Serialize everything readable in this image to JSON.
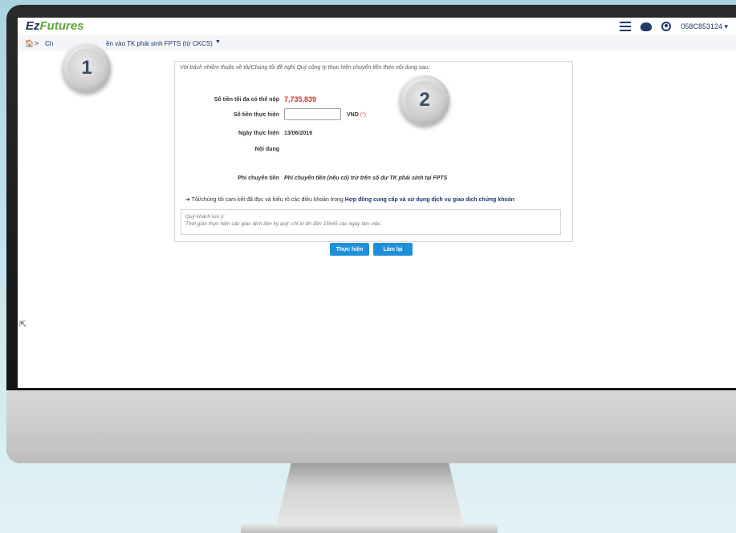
{
  "app": {
    "logo_ez": "Ez",
    "logo_futures": "Futures"
  },
  "header": {
    "account": "058C853124 ▾"
  },
  "breadcrumb": {
    "home": "🏠",
    "separator": ">",
    "prefix": "Ch",
    "current": "ền vào TK phái sinh FPTS (từ CKCS)",
    "caret": "▼"
  },
  "badges": {
    "one": "1",
    "two": "2"
  },
  "form": {
    "intro": "Với trách nhiệm thuộc về tôi/Chúng tôi đề nghị Quý công ty thực hiện chuyển tiền theo nội dung sau:",
    "max_label": "Số tiền tối đa có thể nộp",
    "max_value": "7,735,839",
    "amount_label": "Số tiền thực hiện",
    "amount_value": "",
    "unit": "VND",
    "required_mark": "(*)",
    "date_label": "Ngày thực hiện",
    "date_value": "13/06/2019",
    "content_label": "Nội dung",
    "fee_label": "Phí chuyển tiền",
    "fee_value": "Phí chuyển tiền (nếu có) trừ trên số dư TK phái sinh tại FPTS",
    "commit_prefix": "➜ Tôi/chúng tôi cam kết đã đọc và hiểu rõ các điều khoản trong ",
    "commit_link": "Hợp đồng cung cấp và sử dụng dịch vụ giao dịch chứng khoán",
    "note_title": "Quý khách lưu ý:",
    "note_body": "Thời gian thực hiện các giao dịch tiền ký quỹ: chỉ từ 8h đến 15h45 các ngày làm việc."
  },
  "buttons": {
    "submit": "Thực hiện",
    "reset": "Làm lại"
  },
  "colors": {
    "accent": "#1e90d8",
    "value_red": "#c0392b",
    "nav": "#1f3a6b"
  }
}
